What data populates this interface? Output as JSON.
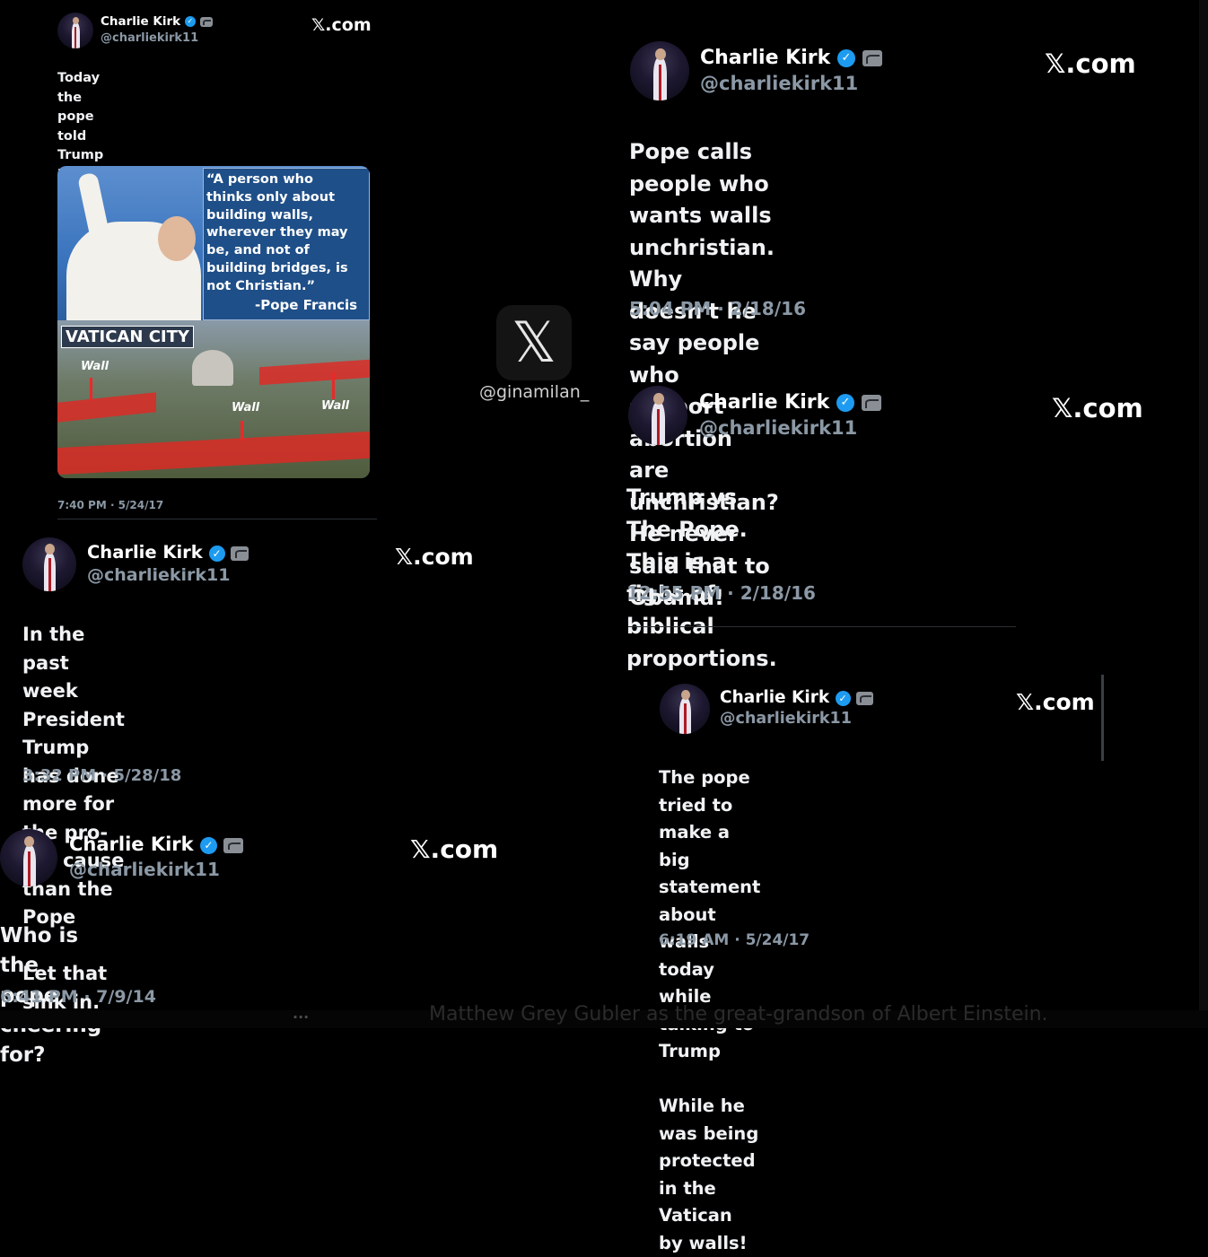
{
  "author": {
    "name": "Charlie Kirk",
    "handle": "@charliekirk11",
    "verified_badge": "verified-icon",
    "affiliation_badge": "affiliate-icon"
  },
  "site_label": "𝕏.com",
  "watermark": "@ginamilan_",
  "x_logo": "𝕏",
  "tweets": [
    {
      "body": "Today the pope told Trump his feelings on\nhow he hates walls.\n\nOh really?",
      "timestamp": "7:40 PM · 5/24/17",
      "image": {
        "quote": "“A person who\nthinks only about\nbuilding walls,\nwherever they may\nbe, and not of\nbuilding bridges, is\nnot Christian.”",
        "quote_author": "-Pope Francis",
        "location_label": "VATICAN CITY",
        "wall_label": "Wall"
      }
    },
    {
      "body": "Pope calls people who wants walls\nunchristian. Why doesn't he say people who\nsupport abortion are unchristian? He never\nsaid that to Obama!",
      "timestamp": "5:04 PM · 2/18/16"
    },
    {
      "body": "Trump vs The Pope. This is a fight of biblical\nproportions.",
      "timestamp": "12:55 PM · 2/18/16"
    },
    {
      "body": "In the past week President Trump has done\nmore for the pro-life cause than the Pope\n\nLet that sink in.",
      "timestamp": "3:32 PM · 5/28/18"
    },
    {
      "body": "The pope tried to make a big statement about\nwalls today while talking to Trump\n\nWhile he was being protected in the Vatican\nby walls!",
      "timestamp": "6:19 AM · 5/24/17"
    },
    {
      "body": "Who is the pope cheering for?",
      "timestamp": "6:41 PM · 7/9/14"
    }
  ],
  "bottom_caption": "Matthew Grey Gubler as the great-grandson of Albert Einstein.",
  "bottom_dots": "···"
}
